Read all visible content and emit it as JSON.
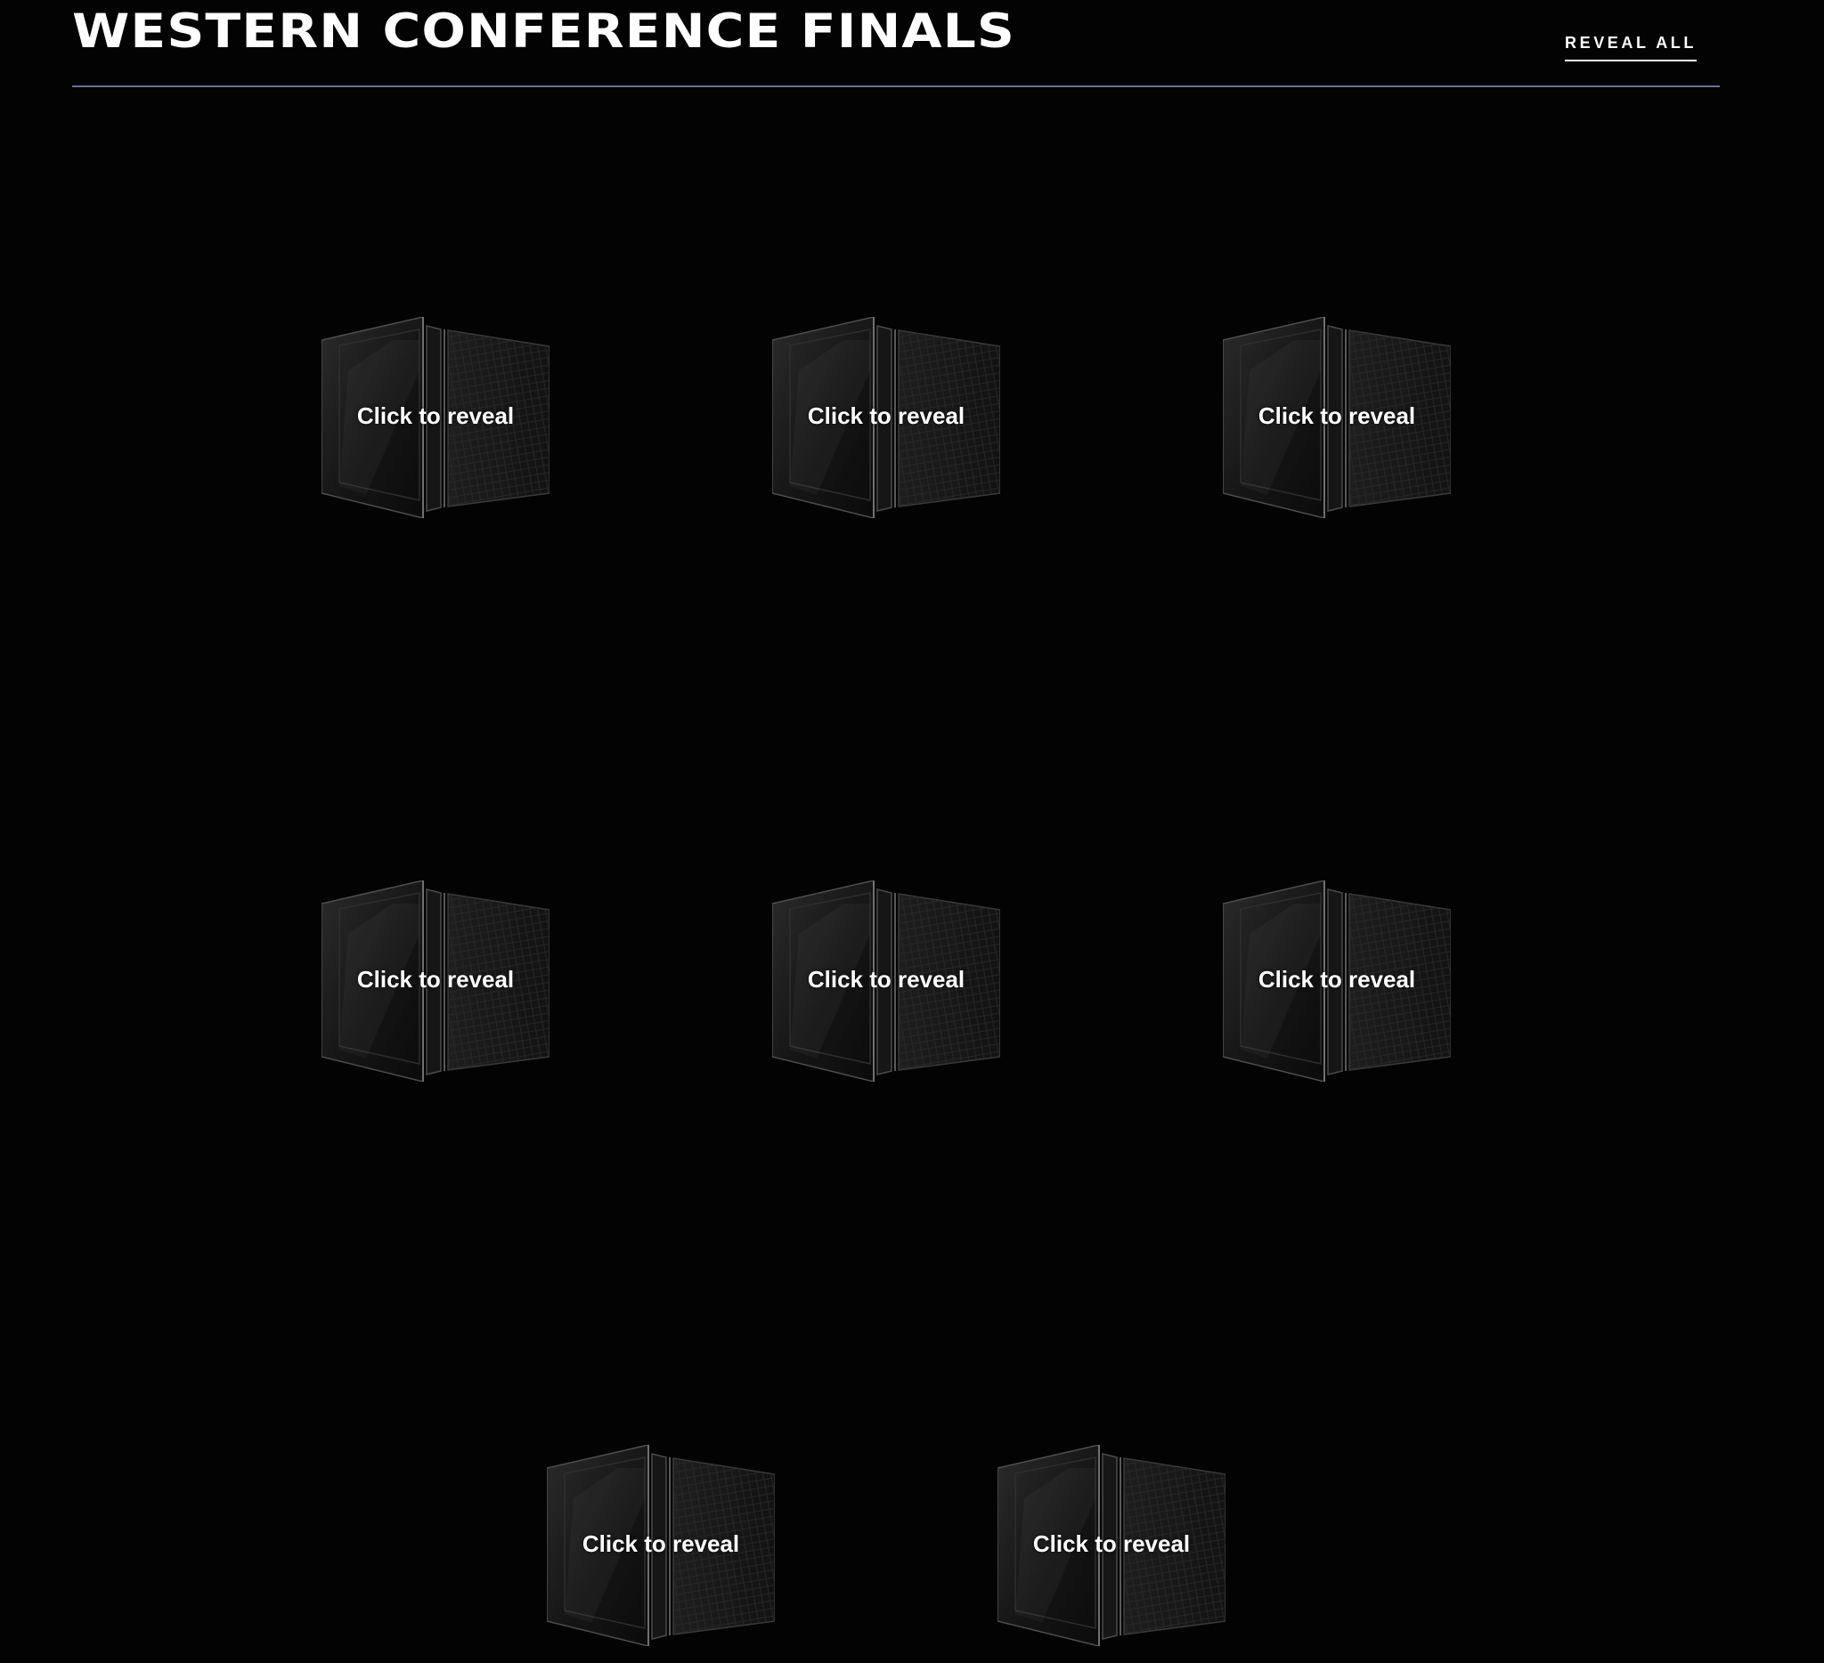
{
  "header": {
    "title": "WESTERN CONFERENCE FINALS",
    "reveal_all_label": "REVEAL ALL"
  },
  "cards": [
    {
      "label": "Click to reveal"
    },
    {
      "label": "Click to reveal"
    },
    {
      "label": "Click to reveal"
    },
    {
      "label": "Click to reveal"
    },
    {
      "label": "Click to reveal"
    },
    {
      "label": "Click to reveal"
    },
    {
      "label": "Click to reveal"
    },
    {
      "label": "Click to reveal"
    }
  ],
  "colors": {
    "background": "#030303",
    "divider": "#6c6f8c",
    "text": "#ffffff"
  }
}
